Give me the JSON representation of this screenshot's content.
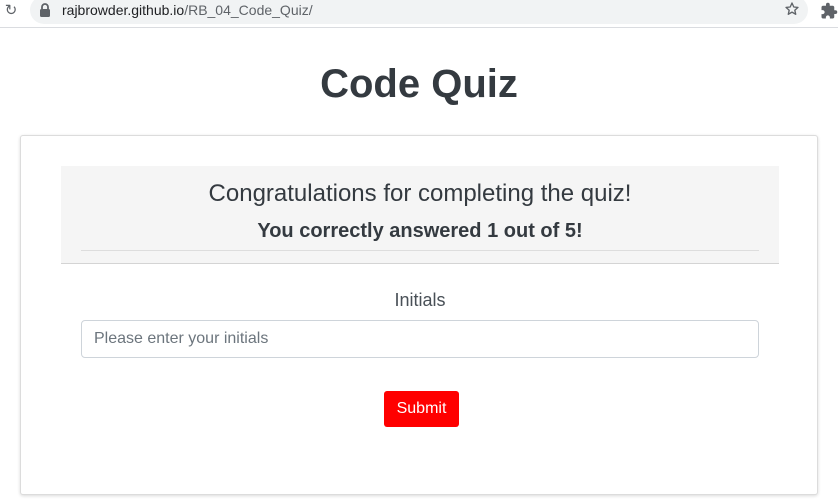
{
  "browser": {
    "url_host": "rajbrowder.github.io",
    "url_path": "/RB_04_Code_Quiz/",
    "icons": [
      "reload-icon",
      "lock-icon",
      "star-icon",
      "extensions-icon"
    ]
  },
  "page": {
    "title": "Code Quiz"
  },
  "result": {
    "congrats": "Congratulations for completing the quiz!",
    "score_text": "You correctly answered 1 out of 5!"
  },
  "form": {
    "initials_label": "Initials",
    "initials_placeholder": "Please enter your initials",
    "initials_value": "",
    "submit_label": "Submit"
  },
  "colors": {
    "submit_bg": "#ff0000",
    "text": "#343a40",
    "result_bg": "#f5f5f5"
  }
}
